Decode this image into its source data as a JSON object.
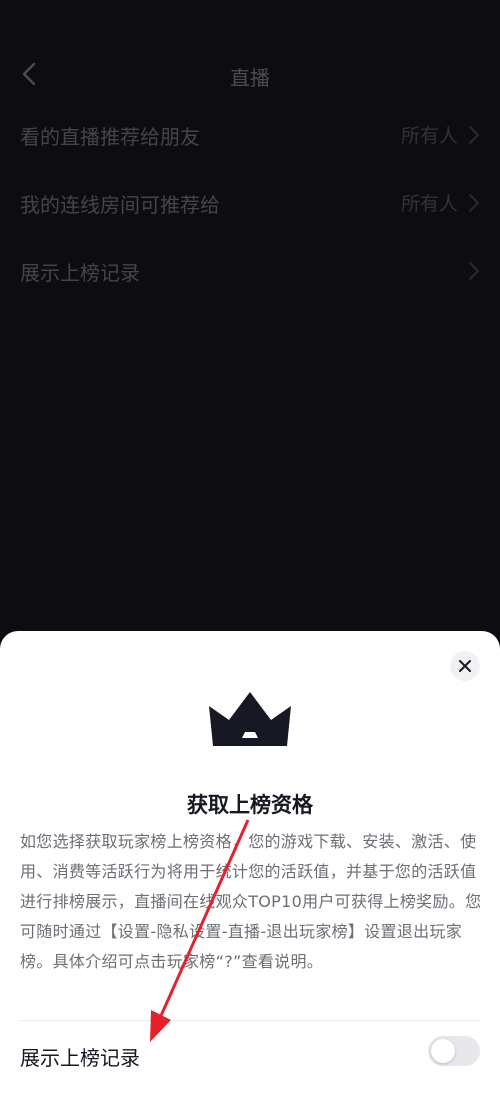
{
  "nav": {
    "title": "直播"
  },
  "settings": [
    {
      "label": "看的直播推荐给朋友",
      "value": "所有人"
    },
    {
      "label": "我的连线房间可推荐给",
      "value": "所有人"
    },
    {
      "label": "展示上榜记录",
      "value": ""
    }
  ],
  "sheet": {
    "title": "获取上榜资格",
    "description": "如您选择获取玩家榜上榜资格，您的游戏下载、安装、激活、使用、消费等活跃行为将用于统计您的活跃值，并基于您的活跃值进行排榜展示，直播间在线观众TOP10用户可获得上榜奖励。您可随时通过【设置-隐私设置-直播-退出玩家榜】设置退出玩家榜。具体介绍可点击玩家榜“?”查看说明。",
    "toggle_label": "展示上榜记录",
    "toggle_on": false
  },
  "icons": {
    "back": "chevron-left-icon",
    "close": "close-icon",
    "crown": "crown-icon",
    "annotation": "red-arrow"
  },
  "colors": {
    "background": "#16161f",
    "sheet": "#ffffff",
    "annotation_arrow": "#e5222b"
  }
}
